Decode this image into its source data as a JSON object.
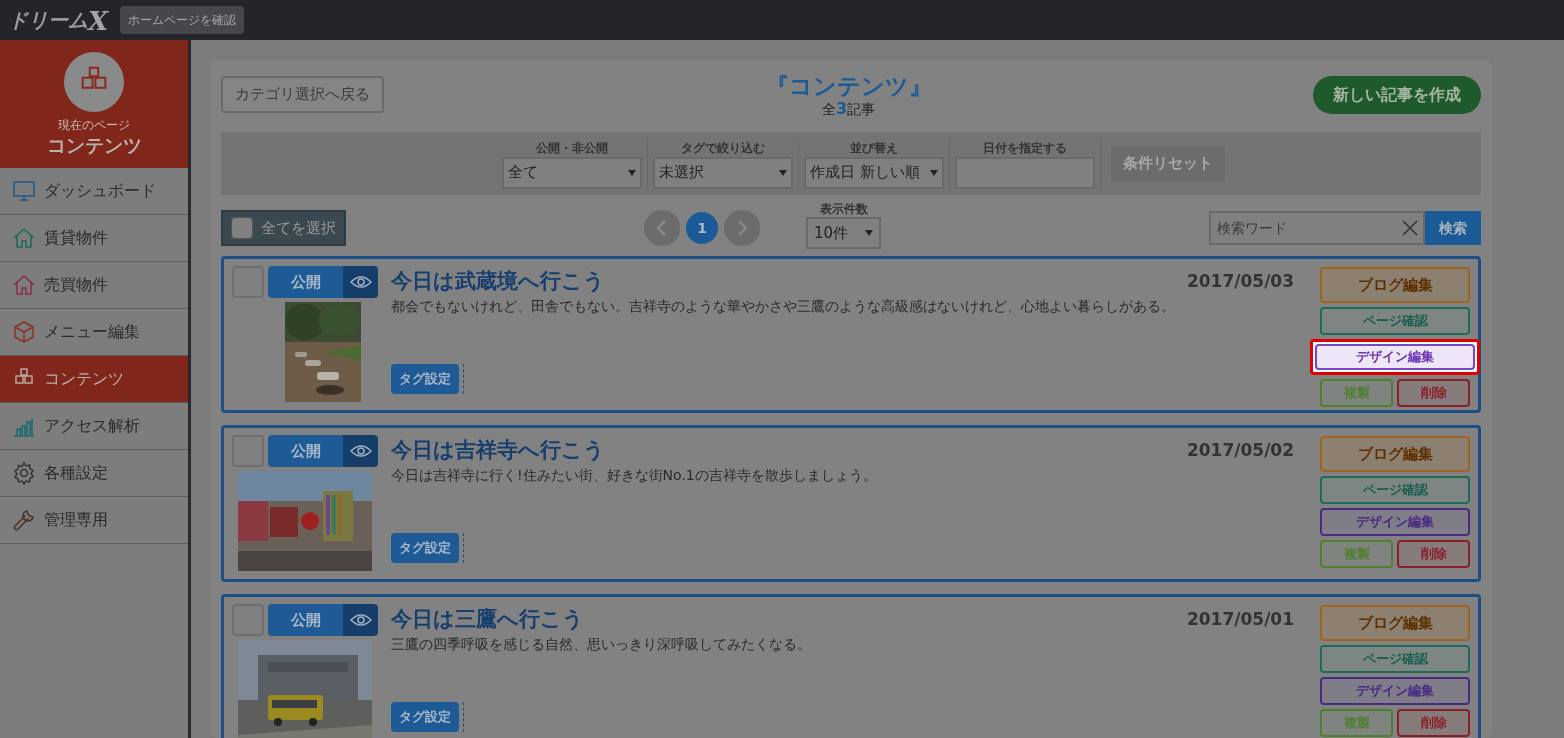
{
  "header": {
    "logo_text": "ドリーム",
    "logo_mark": "X",
    "site_button": "ホームページを確認"
  },
  "sidebar": {
    "current_label": "現在のページ",
    "current_page": "コンテンツ",
    "items": [
      {
        "label": "ダッシュボード",
        "kind": "dashboard",
        "selected": false
      },
      {
        "label": "賃貸物件",
        "kind": "rent",
        "selected": false
      },
      {
        "label": "売買物件",
        "kind": "sale",
        "selected": false
      },
      {
        "label": "メニュー編集",
        "kind": "menu",
        "selected": false
      },
      {
        "label": "コンテンツ",
        "kind": "contents",
        "selected": true
      },
      {
        "label": "アクセス解析",
        "kind": "analytics",
        "selected": false
      },
      {
        "label": "各種設定",
        "kind": "settings",
        "selected": false
      },
      {
        "label": "管理専用",
        "kind": "admin",
        "selected": false
      }
    ]
  },
  "toolbar": {
    "back_button": "カテゴリ選択へ戻る",
    "title": "『コンテンツ』",
    "total_prefix": "全",
    "total_count": "3",
    "total_suffix": "記事",
    "new_button": "新しい記事を作成"
  },
  "filters": {
    "groups": [
      {
        "label": "公開・非公開",
        "kind": "select",
        "value": "全て"
      },
      {
        "label": "タグで絞り込む",
        "kind": "select",
        "value": "未選択"
      },
      {
        "label": "並び替え",
        "kind": "select",
        "value": "作成日 新しい順"
      },
      {
        "label": "日付を指定する",
        "kind": "date"
      }
    ],
    "reset_button": {
      "label": "条件リセット",
      "disabled": true
    }
  },
  "list_controls": {
    "select_all": {
      "label": "全てを選択",
      "checked": false
    },
    "pages": [
      {
        "label": "1",
        "selected": true
      }
    ],
    "per_page_label": "表示件数",
    "per_page": "10件",
    "search_placeholder": "検索ワード",
    "search_button": "検索"
  },
  "articles": [
    {
      "checked": false,
      "status": "公開",
      "title": "今日は武蔵境へ行こう",
      "date": "2017/05/03",
      "excerpt": "都会でもないけれど、田舎でもない。吉祥寺のような華やかさや三鷹のような高級感はないけれど、心地よい暮らしがある。",
      "tag_button": "タグ設定",
      "buttons": [
        {
          "label": "ブログ編集",
          "kind": "blog",
          "highlighted": false
        },
        {
          "label": "ページ確認",
          "kind": "page",
          "highlighted": false
        },
        {
          "label": "デザイン編集",
          "kind": "design",
          "highlighted": true
        },
        {
          "label": "複製",
          "kind": "copy",
          "highlighted": false
        },
        {
          "label": "削除",
          "kind": "delete",
          "highlighted": false
        }
      ]
    },
    {
      "checked": false,
      "status": "公開",
      "title": "今日は吉祥寺へ行こう",
      "date": "2017/05/02",
      "excerpt": "今日は吉祥寺に行く!住みたい街、好きな街No.1の吉祥寺を散歩しましょう。",
      "tag_button": "タグ設定",
      "buttons": [
        {
          "label": "ブログ編集",
          "kind": "blog",
          "highlighted": false
        },
        {
          "label": "ページ確認",
          "kind": "page",
          "highlighted": false
        },
        {
          "label": "デザイン編集",
          "kind": "design",
          "highlighted": false
        },
        {
          "label": "複製",
          "kind": "copy",
          "highlighted": false
        },
        {
          "label": "削除",
          "kind": "delete",
          "highlighted": false
        }
      ]
    },
    {
      "checked": false,
      "status": "公開",
      "title": "今日は三鷹へ行こう",
      "date": "2017/05/01",
      "excerpt": "三鷹の四季呼吸を感じる自然、思いっきり深呼吸してみたくなる。",
      "tag_button": "タグ設定",
      "buttons": [
        {
          "label": "ブログ編集",
          "kind": "blog",
          "highlighted": false
        },
        {
          "label": "ページ確認",
          "kind": "page",
          "highlighted": false
        },
        {
          "label": "デザイン編集",
          "kind": "design",
          "highlighted": false
        },
        {
          "label": "複製",
          "kind": "copy",
          "highlighted": false
        },
        {
          "label": "削除",
          "kind": "delete",
          "highlighted": false
        }
      ]
    }
  ]
}
